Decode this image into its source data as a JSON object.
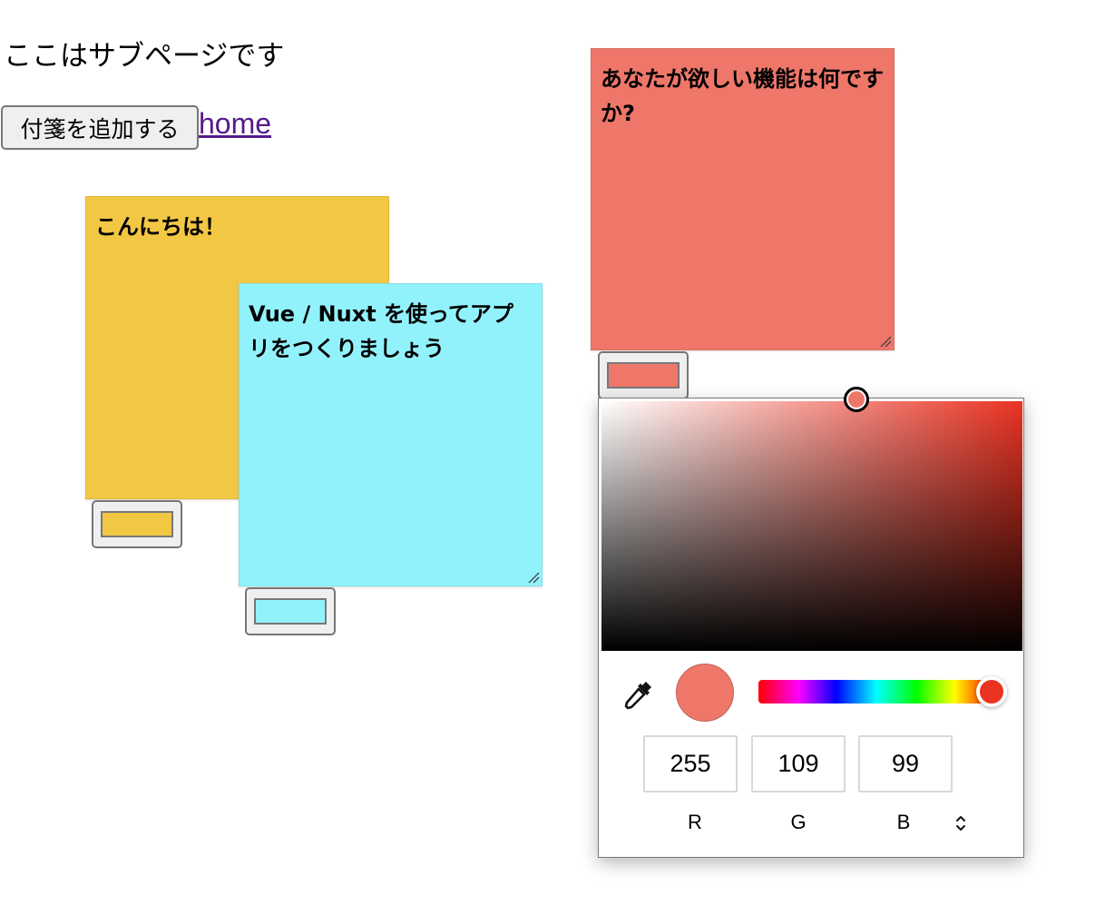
{
  "page": {
    "heading": "ここはサブページです",
    "add_button_label": "付箋を追加する",
    "home_link": "home"
  },
  "notes": [
    {
      "text": "こんにちは！",
      "color": "#f2c744"
    },
    {
      "text": "Vue / Nuxt を使ってアプリをつくりましょう",
      "color": "#92f2fc"
    },
    {
      "text": "あなたが欲しい機能は何ですか?",
      "color": "#ef776a"
    }
  ],
  "color_picker": {
    "current_color": "#ef776a",
    "hue_color": "#ea3323",
    "channels": {
      "r": {
        "value": "255",
        "label": "R"
      },
      "g": {
        "value": "109",
        "label": "G"
      },
      "b": {
        "value": "99",
        "label": "B"
      }
    },
    "icons": {
      "eyedropper": "eyedropper-icon",
      "mode_toggle": "chevron-up-down-icon"
    }
  }
}
